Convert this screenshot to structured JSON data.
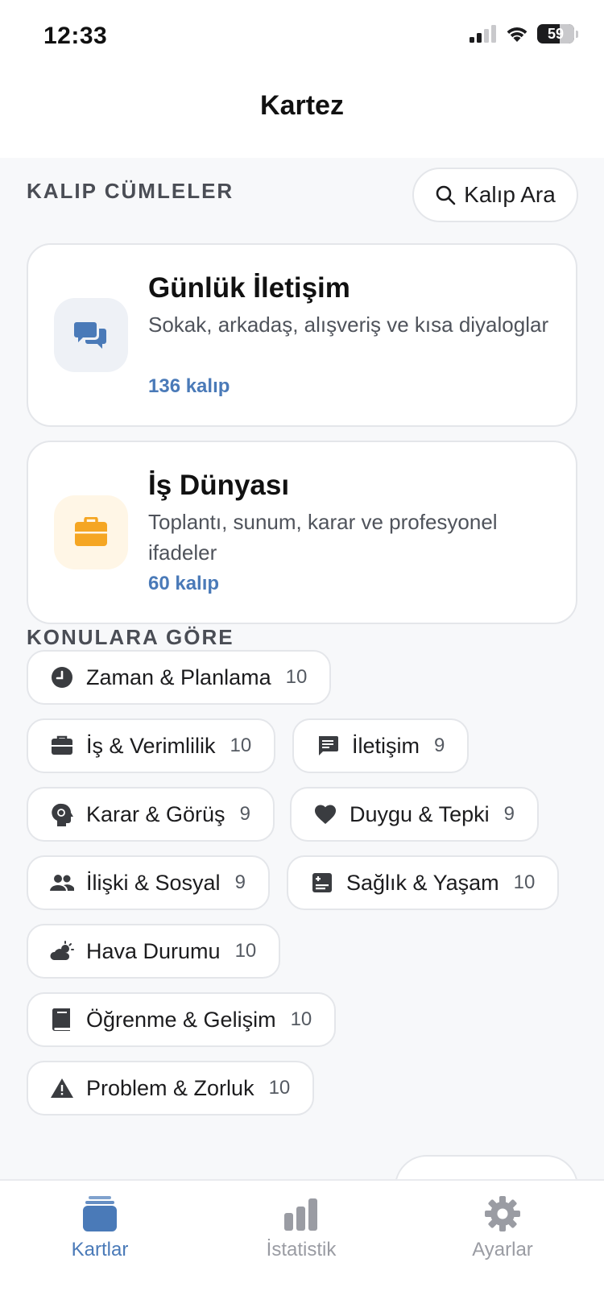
{
  "status_bar": {
    "time": "12:33",
    "battery": "59"
  },
  "header": {
    "title": "Kartez"
  },
  "phrases_section": {
    "title": "KALIP CÜMLELER",
    "search_label": "Kalıp Ara"
  },
  "cards": [
    {
      "title": "Günlük İletişim",
      "desc": "Sokak, arkadaş, alışveriş ve kısa diyaloglar",
      "count": "136 kalıp",
      "icon": "chat-bubbles-icon",
      "icon_bg": "#eef1f6",
      "icon_color": "#4a7ab8"
    },
    {
      "title": "İş Dünyası",
      "desc": "Toplantı, sunum, karar ve profesyonel ifadeler",
      "count": "60 kalıp",
      "icon": "briefcase-icon",
      "icon_bg": "#fff6e6",
      "icon_color": "#f5a623"
    }
  ],
  "topics_section": {
    "title": "KONULARA GÖRE"
  },
  "topics": [
    {
      "label": "Zaman & Planlama",
      "count": "10",
      "icon": "clock-icon"
    },
    {
      "label": "İş & Verimlilik",
      "count": "10",
      "icon": "briefcase-icon"
    },
    {
      "label": "İletişim",
      "count": "9",
      "icon": "message-icon"
    },
    {
      "label": "Karar & Görüş",
      "count": "9",
      "icon": "brain-icon"
    },
    {
      "label": "Duygu & Tepki",
      "count": "9",
      "icon": "heart-icon"
    },
    {
      "label": "İlişki & Sosyal",
      "count": "9",
      "icon": "people-icon"
    },
    {
      "label": "Sağlık & Yaşam",
      "count": "10",
      "icon": "health-icon"
    },
    {
      "label": "Hava Durumu",
      "count": "10",
      "icon": "weather-icon"
    },
    {
      "label": "Öğrenme & Gelişim",
      "count": "10",
      "icon": "book-icon"
    },
    {
      "label": "Problem & Zorluk",
      "count": "10",
      "icon": "warning-icon"
    }
  ],
  "tabs": [
    {
      "label": "Kartlar",
      "icon": "cards-stack-icon",
      "active": true
    },
    {
      "label": "İstatistik",
      "icon": "bar-chart-icon",
      "active": false
    },
    {
      "label": "Ayarlar",
      "icon": "gear-icon",
      "active": false
    }
  ],
  "colors": {
    "accent": "#4a7ab8",
    "inactive": "#9a9ca3",
    "chip_icon": "#3a3c40"
  }
}
